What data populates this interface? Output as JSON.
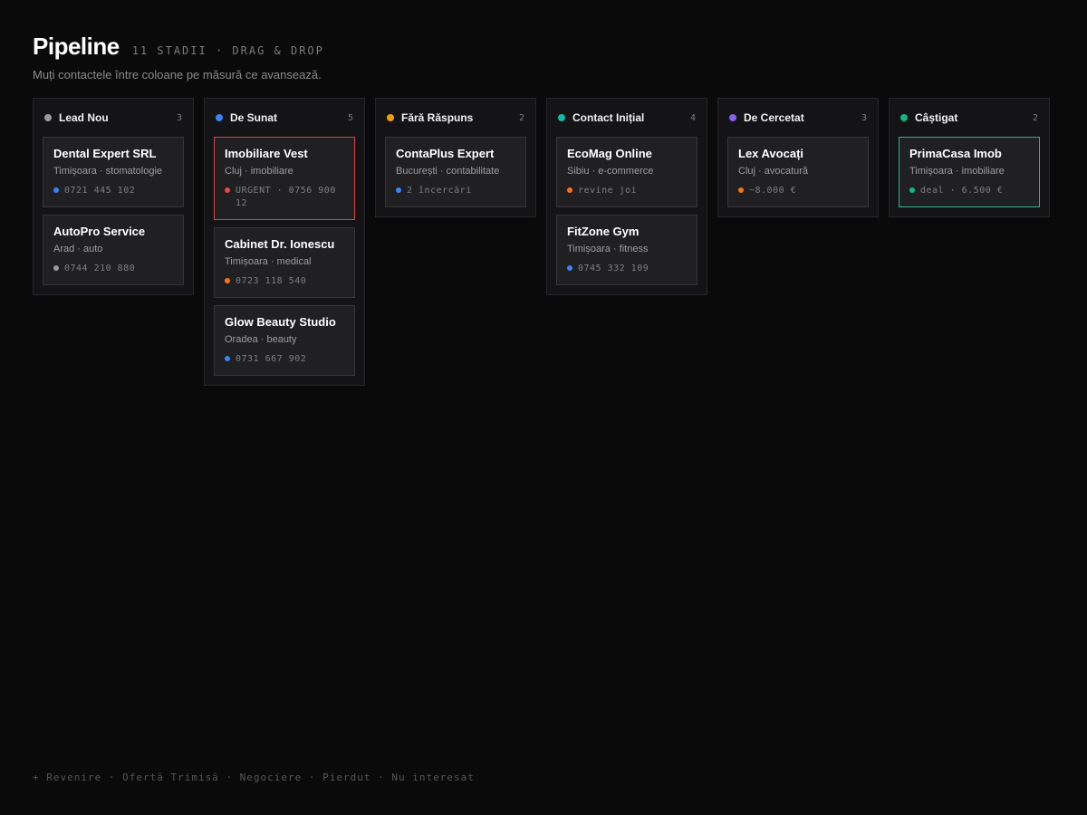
{
  "header": {
    "title": "Pipeline",
    "meta": "11 STADII · DRAG & DROP",
    "subtitle": "Muți contactele între coloane pe măsură ce avansează."
  },
  "colors": {
    "gray": "#9a9a9a",
    "blue": "#3b82f6",
    "orange": "#f59e0b",
    "teal": "#14b8a6",
    "purple": "#8b5cf6",
    "green": "#10b981",
    "red": "#ef4444",
    "urgent_border": "#d64545",
    "won_border": "#2fb38a"
  },
  "columns": [
    {
      "name": "Lead Nou",
      "count": "3",
      "dot": "#9a9a9a",
      "cards": [
        {
          "name": "Dental Expert SRL",
          "sub": "Timișoara · stomatologie",
          "meta": "0721 445 102",
          "dot": "#3b82f6",
          "state": ""
        },
        {
          "name": "AutoPro Service",
          "sub": "Arad · auto",
          "meta": "0744 210 880",
          "dot": "#9a9a9a",
          "state": ""
        }
      ]
    },
    {
      "name": "De Sunat",
      "count": "5",
      "dot": "#3b82f6",
      "cards": [
        {
          "name": "Imobiliare Vest",
          "sub": "Cluj · imobiliare",
          "meta": "URGENT · 0756 900 12",
          "dot": "#ef4444",
          "state": "urgent"
        },
        {
          "name": "Cabinet Dr. Ionescu",
          "sub": "Timișoara · medical",
          "meta": "0723 118 540",
          "dot": "#f97316",
          "state": ""
        },
        {
          "name": "Glow Beauty Studio",
          "sub": "Oradea · beauty",
          "meta": "0731 667 902",
          "dot": "#3b82f6",
          "state": ""
        }
      ]
    },
    {
      "name": "Fără Răspuns",
      "count": "2",
      "dot": "#f59e0b",
      "cards": [
        {
          "name": "ContaPlus Expert",
          "sub": "București · contabilitate",
          "meta": "2 încercări",
          "dot": "#3b82f6",
          "state": ""
        }
      ]
    },
    {
      "name": "Contact Inițial",
      "count": "4",
      "dot": "#14b8a6",
      "cards": [
        {
          "name": "EcoMag Online",
          "sub": "Sibiu · e-commerce",
          "meta": "revine joi",
          "dot": "#f97316",
          "state": ""
        },
        {
          "name": "FitZone Gym",
          "sub": "Timișoara · fitness",
          "meta": "0745 332 109",
          "dot": "#3b82f6",
          "state": ""
        }
      ]
    },
    {
      "name": "De Cercetat",
      "count": "3",
      "dot": "#8b5cf6",
      "cards": [
        {
          "name": "Lex Avocați",
          "sub": "Cluj · avocatură",
          "meta": "~8.000 €",
          "dot": "#f97316",
          "state": ""
        }
      ]
    },
    {
      "name": "Câștigat",
      "count": "2",
      "dot": "#10b981",
      "cards": [
        {
          "name": "PrimaCasa Imob",
          "sub": "Timișoara · imobiliare",
          "meta": "deal · 6.500 €",
          "dot": "#10b981",
          "state": "won"
        }
      ]
    }
  ],
  "footer": {
    "text": "+ Revenire · Ofertă Trimisă · Negociere · Pierdut · Nu interesat"
  }
}
